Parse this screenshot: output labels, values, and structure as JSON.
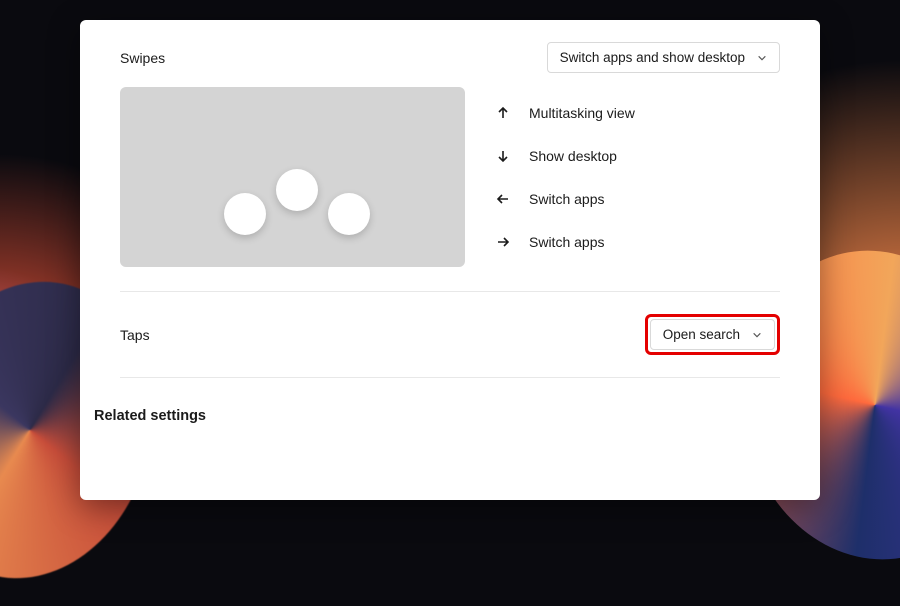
{
  "swipes": {
    "label": "Swipes",
    "dropdown": "Switch apps and show desktop",
    "gestures": [
      {
        "label": "Multitasking view"
      },
      {
        "label": "Show desktop"
      },
      {
        "label": "Switch apps"
      },
      {
        "label": "Switch apps"
      }
    ]
  },
  "taps": {
    "label": "Taps",
    "dropdown": "Open search"
  },
  "related_heading": "Related settings"
}
